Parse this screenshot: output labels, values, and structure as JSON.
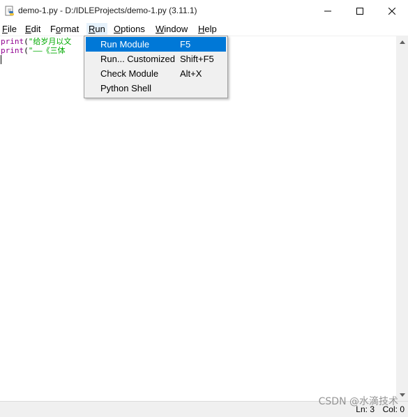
{
  "window": {
    "title": "demo-1.py - D:/IDLEProjects/demo-1.py (3.11.1)"
  },
  "menubar": {
    "items": [
      {
        "key": "F",
        "rest": "ile"
      },
      {
        "key": "E",
        "rest": "dit"
      },
      {
        "key": "",
        "pre": "F",
        "ukey": "o",
        "post": "rmat"
      },
      {
        "key": "R",
        "rest": "un"
      },
      {
        "key": "O",
        "rest": "ptions"
      },
      {
        "key": "W",
        "rest": "indow"
      },
      {
        "key": "H",
        "rest": "elp"
      }
    ]
  },
  "editor": {
    "lines": [
      {
        "fn": "print",
        "open": "(",
        "str": "\"给岁月以文"
      },
      {
        "fn": "print",
        "open": "(",
        "str": "\"——《三体"
      }
    ]
  },
  "run_menu": {
    "items": [
      {
        "label": "Run Module",
        "accel": "F5",
        "highlighted": true
      },
      {
        "label": "Run... Customized",
        "accel": "Shift+F5",
        "highlighted": false
      },
      {
        "label": "Check Module",
        "accel": "Alt+X",
        "highlighted": false
      },
      {
        "label": "Python Shell",
        "accel": "",
        "highlighted": false
      }
    ]
  },
  "statusbar": {
    "line": "Ln: 3",
    "col": "Col: 0"
  },
  "watermark": "CSDN @水滴技术",
  "colors": {
    "menu_highlight": "#0078d7",
    "builtin": "#900090",
    "string": "#00aa00"
  }
}
